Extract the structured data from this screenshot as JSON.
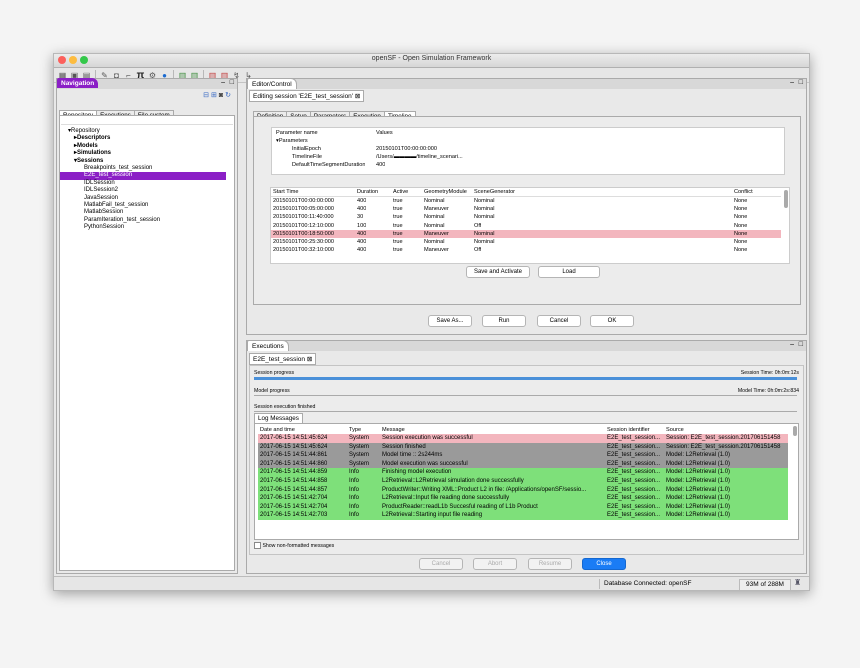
{
  "window": {
    "title": "openSF - Open Simulation Framework"
  },
  "toolbar": {
    "icons": [
      "package-icon",
      "folder-icon",
      "document-icon",
      "wrench-icon",
      "refresh-icon",
      "pin-icon",
      "pi-icon",
      "gear-icon",
      "help-icon",
      "table-icon",
      "table-icon",
      "table-icon",
      "table-icon",
      "arrow-icon",
      "arrow-icon"
    ],
    "pi_label": "π"
  },
  "navigation": {
    "title": "Navigation",
    "tabs": [
      "Repository",
      "Executions",
      "File system"
    ],
    "tree": {
      "root": "Repository",
      "descriptors": "Descriptors",
      "models": "Models",
      "simulations": "Simulations",
      "sessions": "Sessions",
      "items": [
        "Breakpoints_test_session",
        "E2E_test_session",
        "IDLSession",
        "IDLSession2",
        "JavaSession",
        "MatlabFail_test_session",
        "MatlabSession",
        "ParamIteration_test_session",
        "PythonSession"
      ]
    }
  },
  "editor": {
    "panel_title": "Editor/Control",
    "doc_tab": "Editing session 'E2E_test_session'",
    "tabs": [
      "Definition",
      "Setup",
      "Parameters",
      "Execution",
      "Timeline"
    ],
    "params_header": {
      "name": "Parameter name",
      "values": "Values"
    },
    "params": [
      {
        "name": "Parameters",
        "value": ""
      },
      {
        "name": "InitialEpoch",
        "value": "20150101T00:00:00:000"
      },
      {
        "name": "TimelineFile",
        "value": "/Users/▬▬▬▬/timeline_scenari..."
      },
      {
        "name": "DefaultTimeSegmentDuration",
        "value": "400"
      }
    ],
    "timeline_header": [
      "Start Time",
      "Duration",
      "Active",
      "GeometryModule",
      "SceneGenerator",
      "Conflict"
    ],
    "timeline_rows": [
      [
        "20150101T00:00:00:000",
        "400",
        "true",
        "Nominal",
        "Nominal",
        "None"
      ],
      [
        "20150101T00:05:00:000",
        "400",
        "true",
        "Maneuver",
        "Nominal",
        "None"
      ],
      [
        "20150101T00:11:40:000",
        "30",
        "true",
        "Nominal",
        "Nominal",
        "None"
      ],
      [
        "20150101T00:12:10:000",
        "100",
        "true",
        "Nominal",
        "Off",
        "None"
      ],
      [
        "20150101T00:18:50:000",
        "400",
        "true",
        "Maneuver",
        "Nominal",
        "None"
      ],
      [
        "20150101T00:25:30:000",
        "400",
        "true",
        "Nominal",
        "Nominal",
        "None"
      ],
      [
        "20150101T00:32:10:000",
        "400",
        "true",
        "Maneuver",
        "Off",
        "None"
      ]
    ],
    "buttons": {
      "save_activate": "Save and Activate",
      "load": "Load",
      "save_as": "Save As...",
      "run": "Run",
      "cancel": "Cancel",
      "ok": "OK"
    }
  },
  "executions": {
    "panel_title": "Executions",
    "doc_tab": "E2E_test_session",
    "session_progress_label": "Session progress",
    "session_time": "Session Time: 0h:0m:12s",
    "session_progress": 1.0,
    "model_progress_label": "Model progress",
    "model_time": "Model Time: 0h:0m:2s:834",
    "status": "Session execution finished",
    "log_tab": "Log Messages",
    "log_header": [
      "Date and time",
      "Type",
      "Message",
      "Session identifier",
      "Source"
    ],
    "log_rows": [
      {
        "date": "2017-06-15 14:51:45:624",
        "type": "System",
        "msg": "Session execution was successful",
        "sid": "E2E_test_session...",
        "src": "Session: E2E_test_session.201706151458",
        "color": "#f3b6be"
      },
      {
        "date": "2017-06-15 14:51:45:624",
        "type": "System",
        "msg": "Session finished",
        "sid": "E2E_test_session...",
        "src": "Session: E2E_test_session.201706151458",
        "color": "#9a9a9a"
      },
      {
        "date": "2017-06-15 14:51:44:861",
        "type": "System",
        "msg": "Model time :: 2s244ms",
        "sid": "E2E_test_session...",
        "src": "Model: L2Retrieval (1.0)",
        "color": "#9a9a9a"
      },
      {
        "date": "2017-06-15 14:51:44:860",
        "type": "System",
        "msg": "Model execution was successful",
        "sid": "E2E_test_session...",
        "src": "Model: L2Retrieval (1.0)",
        "color": "#9a9a9a"
      },
      {
        "date": "2017-06-15 14:51:44:859",
        "type": "Info",
        "msg": "Finishing model execution",
        "sid": "E2E_test_session...",
        "src": "Model: L2Retrieval (1.0)",
        "color": "#7ee07a"
      },
      {
        "date": "2017-06-15 14:51:44:858",
        "type": "Info",
        "msg": "L2Retrieval::L2Retrieval simulation done successfully",
        "sid": "E2E_test_session...",
        "src": "Model: L2Retrieval (1.0)",
        "color": "#7ee07a"
      },
      {
        "date": "2017-06-15 14:51:44:857",
        "type": "Info",
        "msg": "ProductWriter::Writing XML::Product L2 in file: /Applications/openSF/sessio...",
        "sid": "E2E_test_session...",
        "src": "Model: L2Retrieval (1.0)",
        "color": "#7ee07a"
      },
      {
        "date": "2017-06-15 14:51:42:704",
        "type": "Info",
        "msg": "L2Retrieval::Input file reading done successfully",
        "sid": "E2E_test_session...",
        "src": "Model: L2Retrieval (1.0)",
        "color": "#7ee07a"
      },
      {
        "date": "2017-06-15 14:51:42:704",
        "type": "Info",
        "msg": "ProductReader::readL1b Succesful reading of L1b Product",
        "sid": "E2E_test_session...",
        "src": "Model: L2Retrieval (1.0)",
        "color": "#7ee07a"
      },
      {
        "date": "2017-06-15 14:51:42:703",
        "type": "Info",
        "msg": "L2Retrieval::Starting input file reading",
        "sid": "E2E_test_session...",
        "src": "Model: L2Retrieval (1.0)",
        "color": "#7ee07a"
      }
    ],
    "show_formatted": "Show non-formatted messages",
    "buttons": {
      "cancel": "Cancel",
      "abort": "Abort",
      "resume": "Resume",
      "close": "Close"
    }
  },
  "statusbar": {
    "db": "Database Connected: openSF",
    "memory": "93M of 288M"
  },
  "colors": {
    "selection": "#8b1fc6",
    "highlight": "#f3b6be",
    "progress": "#4a90d9"
  }
}
